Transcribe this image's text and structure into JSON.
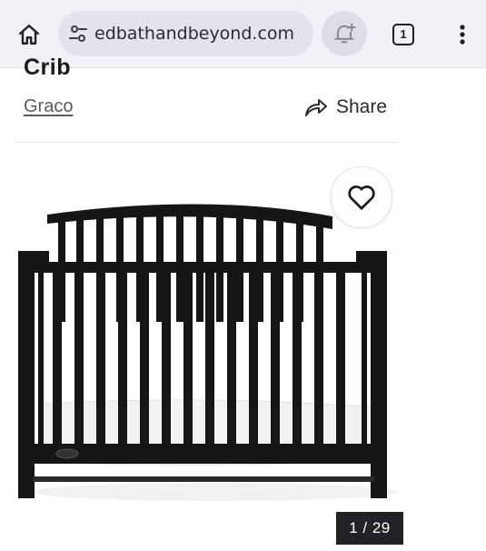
{
  "browser": {
    "url": "edbathandbeyond.com",
    "tab_count": "1",
    "icons": {
      "home": "home-icon",
      "site_settings": "tune-icon",
      "notification": "add-alert-icon",
      "tabs": "tab-switcher-icon",
      "menu": "more-vert-icon"
    }
  },
  "product": {
    "title": "Crib",
    "brand": "Graco",
    "share_label": "Share"
  },
  "gallery": {
    "counter": "1 / 29",
    "favorite_icon": "heart-outline-icon",
    "image_alt": "crib-image"
  },
  "colors": {
    "chrome_bg": "#f1f2f8",
    "counter_bg": "#222326",
    "crib": "#161616"
  }
}
